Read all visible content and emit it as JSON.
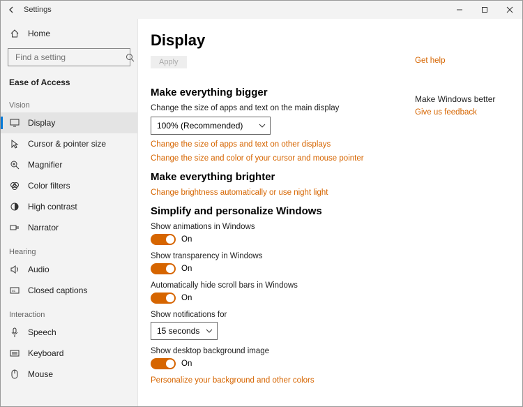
{
  "window": {
    "title": "Settings"
  },
  "sidebar": {
    "home_label": "Home",
    "search_placeholder": "Find a setting",
    "category": "Ease of Access",
    "groups": {
      "vision": {
        "header": "Vision",
        "items": [
          "Display",
          "Cursor & pointer size",
          "Magnifier",
          "Color filters",
          "High contrast",
          "Narrator"
        ]
      },
      "hearing": {
        "header": "Hearing",
        "items": [
          "Audio",
          "Closed captions"
        ]
      },
      "interaction": {
        "header": "Interaction",
        "items": [
          "Speech",
          "Keyboard",
          "Mouse"
        ]
      }
    }
  },
  "page": {
    "title": "Display",
    "apply_button": "Apply",
    "sections": {
      "bigger": {
        "heading": "Make everything bigger",
        "desc": "Change the size of apps and text on the main display",
        "dropdown_value": "100% (Recommended)",
        "link_other_displays": "Change the size of apps and text on other displays",
        "link_cursor": "Change the size and color of your cursor and mouse pointer"
      },
      "brighter": {
        "heading": "Make everything brighter",
        "link_brightness": "Change brightness automatically or use night light"
      },
      "simplify": {
        "heading": "Simplify and personalize Windows",
        "animations": {
          "label": "Show animations in Windows",
          "state": "On"
        },
        "transparency": {
          "label": "Show transparency in Windows",
          "state": "On"
        },
        "scrollbars": {
          "label": "Automatically hide scroll bars in Windows",
          "state": "On"
        },
        "notifications": {
          "label": "Show notifications for",
          "value": "15 seconds"
        },
        "desktop_bg": {
          "label": "Show desktop background image",
          "state": "On"
        },
        "link_personalize": "Personalize your background and other colors"
      }
    }
  },
  "right_panel": {
    "help_link": "Get help",
    "better_heading": "Make Windows better",
    "feedback_link": "Give us feedback"
  }
}
